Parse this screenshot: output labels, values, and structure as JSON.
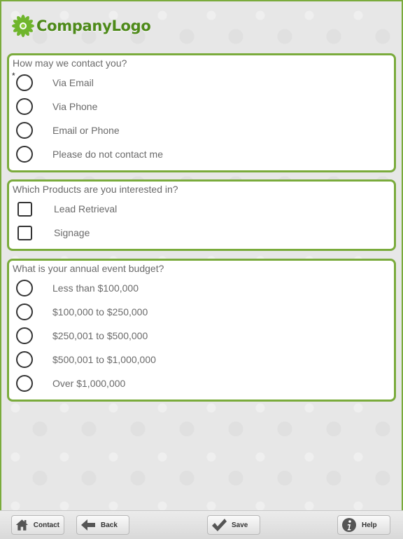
{
  "header": {
    "logo_text": "CompanyLogo"
  },
  "contact": {
    "question": "How may we contact you?",
    "required_mark": "*",
    "options": [
      "Via Email",
      "Via Phone",
      "Email or Phone",
      "Please do not contact me"
    ]
  },
  "products": {
    "question": "Which Products are you interested in?",
    "options": [
      "Lead Retrieval",
      "Signage"
    ]
  },
  "budget": {
    "question": "What is your annual event budget?",
    "options": [
      "Less than $100,000",
      "$100,000 to $250,000",
      "$250,001 to $500,000",
      "$500,001 to $1,000,000",
      "Over $1,000,000"
    ]
  },
  "toolbar": {
    "contact_label": "Contact",
    "back_label": "Back",
    "save_label": "Save",
    "help_label": "Help"
  },
  "colors": {
    "accent": "#7aab3c",
    "logo": "#4e8a1a"
  },
  "icons": [
    "flower-logo-icon",
    "home-icon",
    "back-arrow-icon",
    "checkmark-icon",
    "info-icon"
  ]
}
